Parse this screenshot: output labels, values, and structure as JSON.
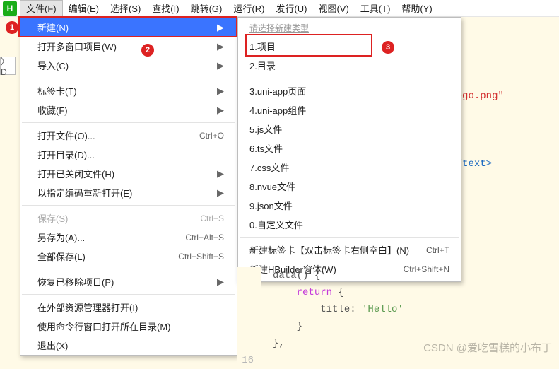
{
  "logo_text": "H",
  "menubar": [
    "文件(F)",
    "编辑(E)",
    "选择(S)",
    "查找(I)",
    "跳转(G)",
    "运行(R)",
    "发行(U)",
    "视图(V)",
    "工具(T)",
    "帮助(Y)"
  ],
  "file_menu": {
    "groups": [
      [
        {
          "label": "新建(N)",
          "arrow": true,
          "highlight": true
        },
        {
          "label": "打开多窗口项目(W)",
          "arrow": true
        },
        {
          "label": "导入(C)",
          "arrow": true
        }
      ],
      [
        {
          "label": "标签卡(T)",
          "arrow": true
        },
        {
          "label": "收藏(F)",
          "arrow": true
        }
      ],
      [
        {
          "label": "打开文件(O)...",
          "shortcut": "Ctrl+O"
        },
        {
          "label": "打开目录(D)..."
        },
        {
          "label": "打开已关闭文件(H)",
          "arrow": true
        },
        {
          "label": "以指定编码重新打开(E)",
          "arrow": true
        }
      ],
      [
        {
          "label": "保存(S)",
          "shortcut": "Ctrl+S",
          "disabled": true
        },
        {
          "label": "另存为(A)...",
          "shortcut": "Ctrl+Alt+S"
        },
        {
          "label": "全部保存(L)",
          "shortcut": "Ctrl+Shift+S"
        }
      ],
      [
        {
          "label": "恢复已移除项目(P)",
          "arrow": true
        }
      ],
      [
        {
          "label": "在外部资源管理器打开(I)"
        },
        {
          "label": "使用命令行窗口打开所在目录(M)"
        },
        {
          "label": "退出(X)"
        }
      ]
    ]
  },
  "submenu": {
    "header": "请选择新建类型",
    "groups": [
      [
        {
          "label": "1.项目",
          "boxed": true
        },
        {
          "label": "2.目录"
        }
      ],
      [
        {
          "label": "3.uni-app页面"
        },
        {
          "label": "4.uni-app组件"
        },
        {
          "label": "5.js文件"
        },
        {
          "label": "6.ts文件"
        },
        {
          "label": "7.css文件"
        },
        {
          "label": "8.nvue文件"
        },
        {
          "label": "9.json文件"
        },
        {
          "label": "0.自定义文件"
        }
      ],
      [
        {
          "label": "新建标签卡【双击标签卡右侧空白】(N)",
          "shortcut": "Ctrl+T"
        },
        {
          "label": "新建HBuilder窗体(W)",
          "shortcut": "Ctrl+Shift+N"
        }
      ]
    ]
  },
  "badges": {
    "b1": "1",
    "b2": "2",
    "b3": "3"
  },
  "bg_code": {
    "l1": ":/logo.png\"",
    "l2": "}}</text>"
  },
  "code": {
    "lines": {
      "n16": "16"
    },
    "l1_a": "data",
    "l1_b": "() {",
    "l2_a": "return",
    "l2_b": " {",
    "l3_a": "title: ",
    "l3_b": "'Hello'",
    "l4": "}",
    "l5": "},"
  },
  "watermark": "CSDN @爱吃雪糕的小布丁",
  "left_tree": "〉D"
}
